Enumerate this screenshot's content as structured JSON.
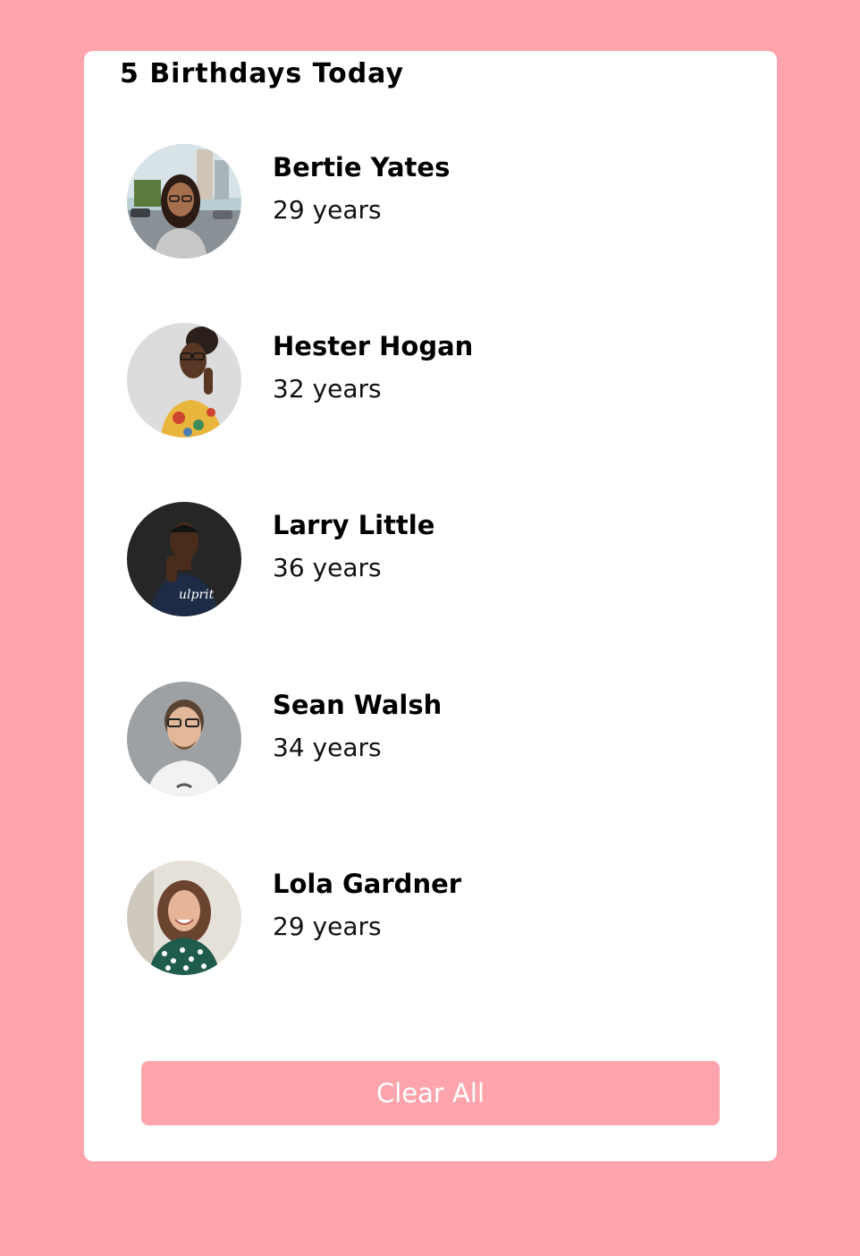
{
  "header": {
    "title": "5 Birthdays Today"
  },
  "people": [
    {
      "name": "Bertie Yates",
      "age": "29 years"
    },
    {
      "name": "Hester Hogan",
      "age": "32 years"
    },
    {
      "name": "Larry Little",
      "age": "36 years"
    },
    {
      "name": "Sean Walsh",
      "age": "34 years"
    },
    {
      "name": "Lola Gardner",
      "age": "29 years"
    }
  ],
  "actions": {
    "clear_label": "Clear All"
  },
  "colors": {
    "background": "#fda4ad",
    "card": "#ffffff",
    "button": "#fda4ad",
    "button_text": "#ffffff"
  }
}
